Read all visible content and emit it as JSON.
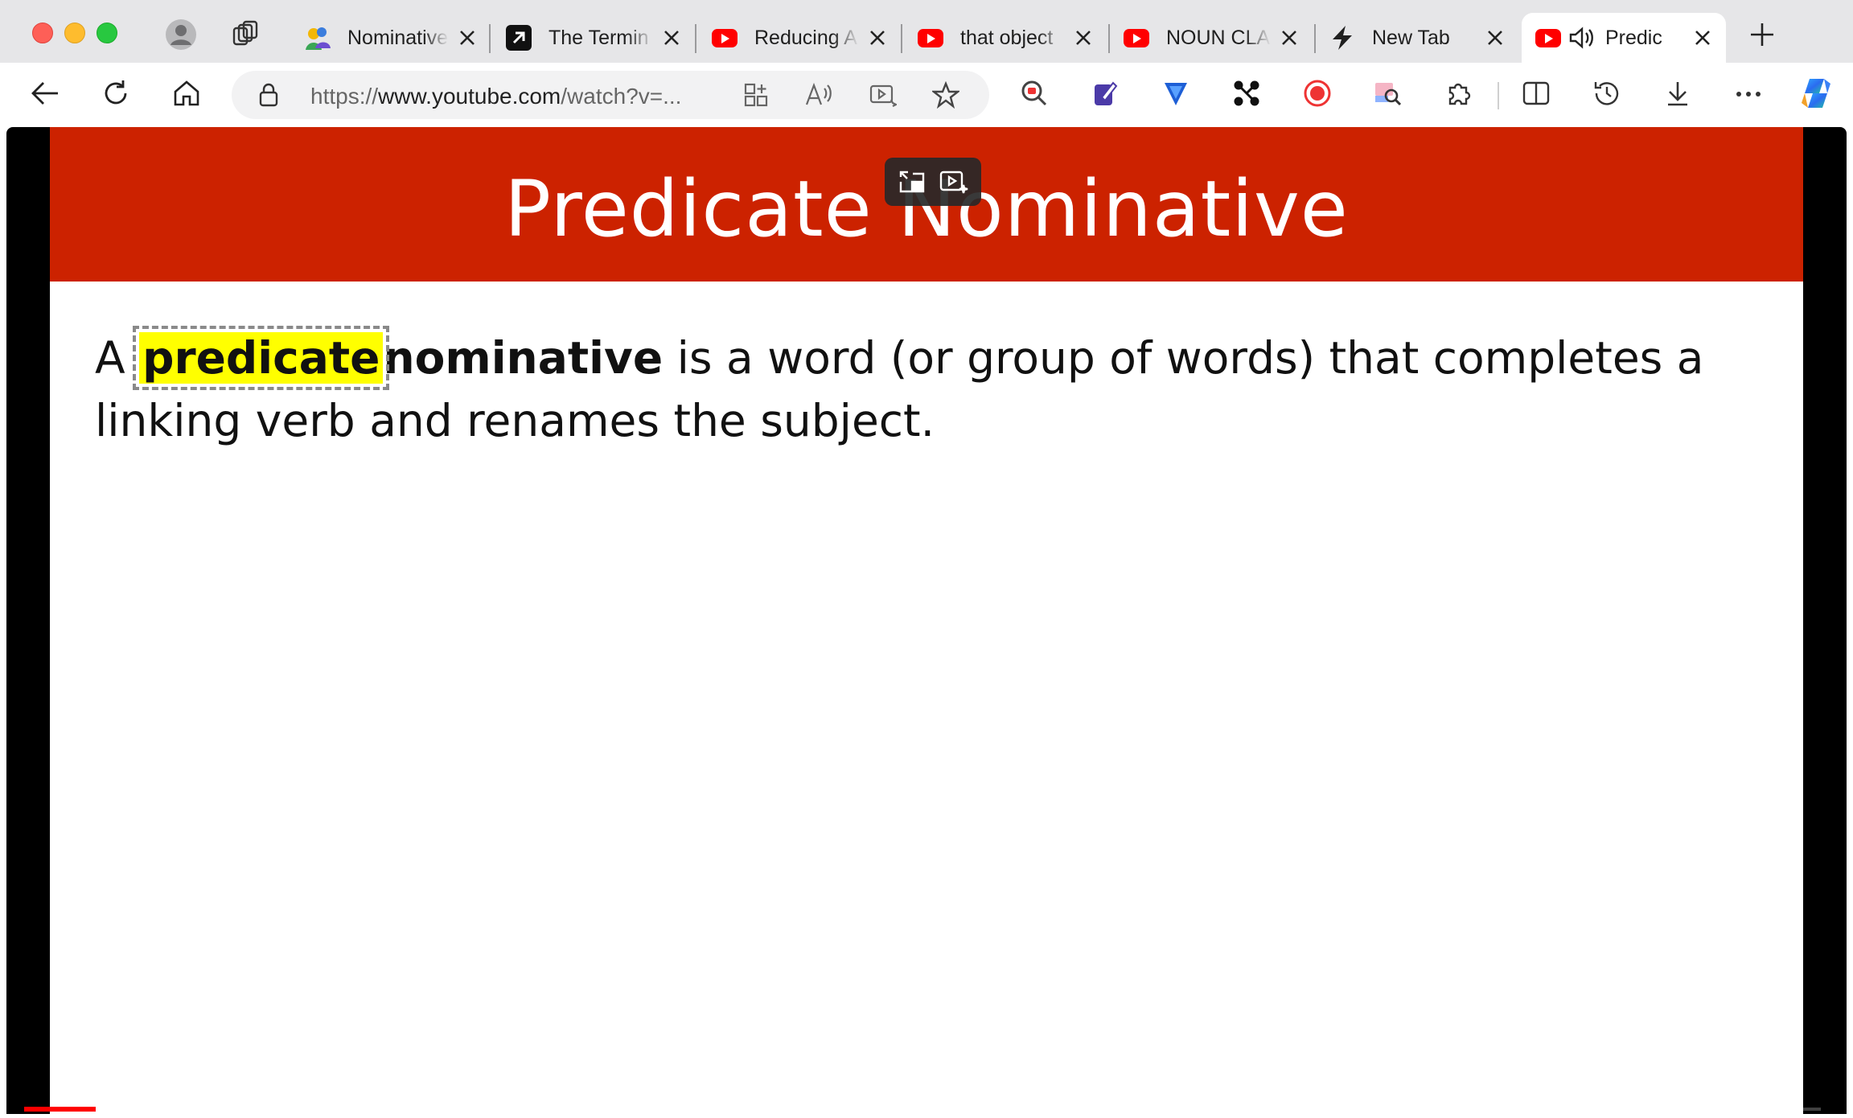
{
  "window": {
    "controls": [
      "close",
      "minimize",
      "zoom"
    ]
  },
  "tabs": [
    {
      "title": "Nominative",
      "icon": "people-favicon",
      "active": false
    },
    {
      "title": "The Termin",
      "icon": "arrow-favicon",
      "active": false
    },
    {
      "title": "Reducing A",
      "icon": "youtube-favicon",
      "active": false
    },
    {
      "title": "that object",
      "icon": "youtube-favicon",
      "active": false
    },
    {
      "title": "NOUN CLA",
      "icon": "youtube-favicon",
      "active": false
    },
    {
      "title": "New Tab",
      "icon": "bolt-favicon",
      "active": false
    },
    {
      "title": "Predic",
      "icon": "youtube-favicon",
      "active": true,
      "audio": true
    }
  ],
  "toolbar": {
    "url_scheme": "https://",
    "url_host": "www.youtube.com",
    "url_path": "/watch?v=..."
  },
  "slide": {
    "title": "Predicate Nominative",
    "body": {
      "a": "A",
      "highlight": "predicate",
      "bold": "nominative",
      "rest_line1": " is a word (or group of words) that completes a",
      "line2": "linking verb and renames the subject."
    }
  },
  "video": {
    "progress_fraction": 0.04
  },
  "colors": {
    "slide_header": "#cc2200",
    "highlight": "#ffff00",
    "progress": "#ff0000"
  }
}
